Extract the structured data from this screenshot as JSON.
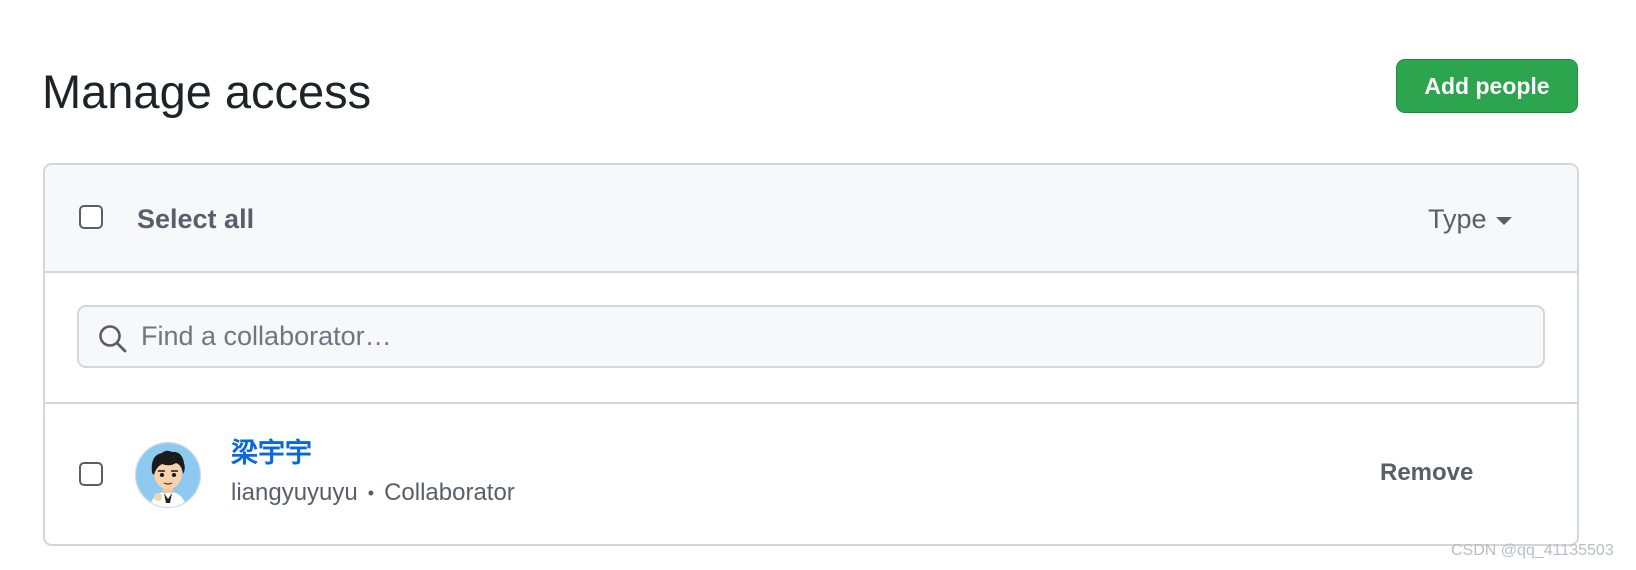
{
  "header": {
    "title": "Manage access",
    "add_button_label": "Add people"
  },
  "list_header": {
    "select_all_label": "Select all",
    "type_filter_label": "Type"
  },
  "search": {
    "placeholder": "Find a collaborator…",
    "value": ""
  },
  "members": [
    {
      "display_name": "梁宇宇",
      "username": "liangyuyuyu",
      "separator": "•",
      "role": "Collaborator",
      "action_label": "Remove"
    }
  ],
  "watermark": "CSDN @qq_41135503",
  "colors": {
    "primary_button": "#2da44e",
    "link": "#0969da",
    "muted_text": "#57606a",
    "border": "#d0d7de",
    "header_bg": "#f6f8fa"
  }
}
